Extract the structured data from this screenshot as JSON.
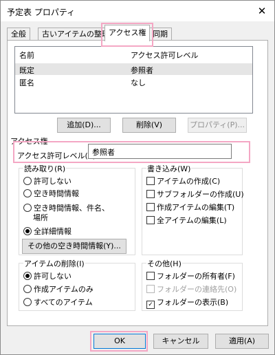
{
  "window": {
    "title": "予定表 プロパティ",
    "close_glyph": "✕"
  },
  "tabs": [
    {
      "label": "全般"
    },
    {
      "label": "古いアイテムの整理"
    },
    {
      "label": "アクセス権"
    },
    {
      "label": "同期"
    }
  ],
  "list": {
    "headers": [
      "名前",
      "アクセス許可レベル"
    ],
    "rows": [
      {
        "name": "既定",
        "level": "参照者"
      },
      {
        "name": "匿名",
        "level": "なし"
      }
    ]
  },
  "list_buttons": {
    "add": "追加(D)...",
    "delete": "削除(V)",
    "properties": "プロパティ(P)..."
  },
  "access": {
    "section": "アクセス権",
    "level_label": "アクセス許可レベル(S):",
    "level_value": "参照者"
  },
  "read": {
    "label": "読み取り(R)",
    "options": [
      "許可しない",
      "空き時間情報",
      "空き時間情報、件名、",
      "場所",
      "全詳細情報"
    ],
    "button": "その他の空き時間情報(Y)..."
  },
  "write": {
    "label": "書き込み(W)",
    "options": [
      "アイテムの作成(C)",
      "サブフォルダーの作成(U)",
      "作成アイテムの編集(T)",
      "全アイテムの編集(L)"
    ]
  },
  "delete_group": {
    "label": "アイテムの削除(I)",
    "options": [
      "許可しない",
      "作成アイテムのみ",
      "すべてのアイテム"
    ]
  },
  "other": {
    "label": "その他(H)",
    "options": [
      "フォルダーの所有者(F)",
      "フォルダーの連絡先(O)",
      "フォルダーの表示(B)"
    ],
    "check_glyph": "✓"
  },
  "footer": {
    "ok": "OK",
    "cancel": "キャンセル",
    "apply": "適用(A)"
  }
}
